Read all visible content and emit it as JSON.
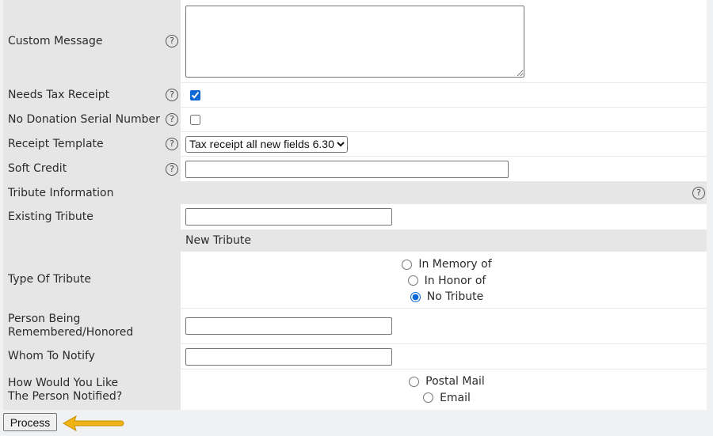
{
  "fields": {
    "custom_message": {
      "label": "Custom Message",
      "value": ""
    },
    "needs_tax_receipt": {
      "label": "Needs Tax Receipt",
      "checked": true
    },
    "no_donation_serial": {
      "label": "No Donation Serial Number",
      "checked": false
    },
    "receipt_template": {
      "label": "Receipt Template",
      "selected": "Tax receipt all new fields 6.30"
    },
    "soft_credit": {
      "label": "Soft Credit",
      "value": ""
    }
  },
  "tribute": {
    "section_title": "Tribute Information",
    "existing_label": "Existing Tribute",
    "existing_value": "",
    "new_title": "New Tribute",
    "type_label": "Type Of Tribute",
    "type_options": [
      "In Memory of",
      "In Honor of",
      "No Tribute"
    ],
    "type_selected": "No Tribute",
    "person_label_line1": "Person Being",
    "person_label_line2": "Remembered/Honored",
    "person_value": "",
    "notify_label": "Whom To Notify",
    "notify_value": "",
    "method_label_line1": "How Would You Like",
    "method_label_line2": "The Person Notified?",
    "method_options": [
      "Postal Mail",
      "Email"
    ]
  },
  "help_glyph": "?",
  "process_button": "Process",
  "colors": {
    "accent": "#0b68d6",
    "label_bg": "#e6e6e6",
    "arrow": "#f1b416"
  },
  "icons": {
    "help": "help-icon",
    "arrow": "arrow-left-icon"
  }
}
